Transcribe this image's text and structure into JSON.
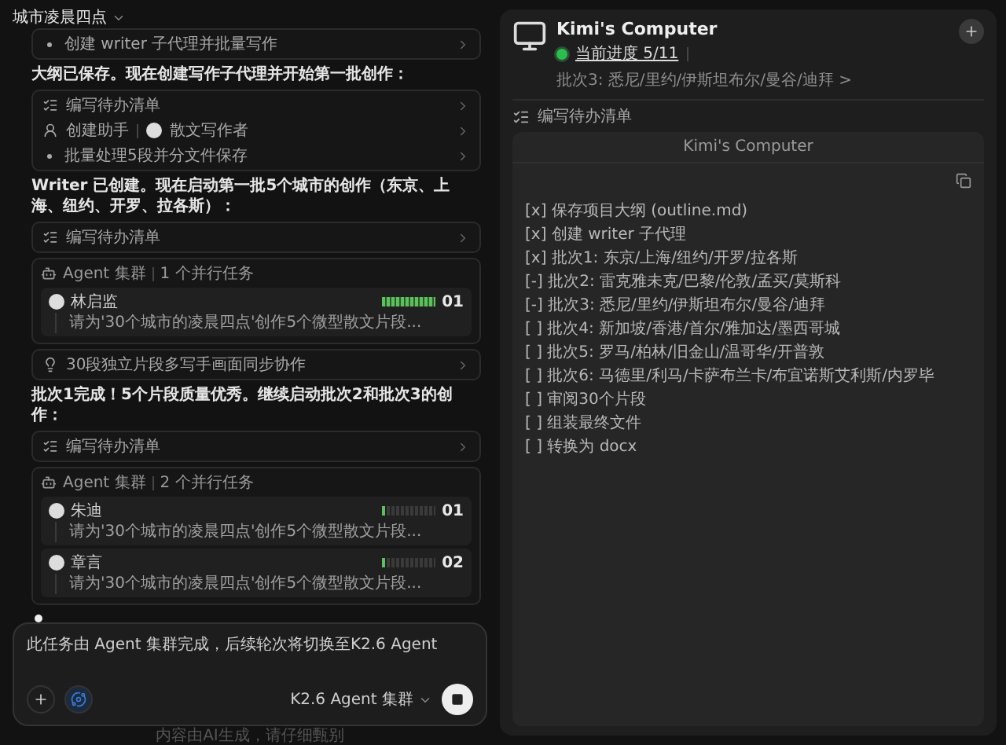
{
  "conversation": {
    "title": "城市凌晨四点"
  },
  "messages": [
    {
      "kind": "steps",
      "items": [
        {
          "kind": "bullet",
          "label": "创建 writer 子代理并批量写作"
        }
      ]
    },
    {
      "kind": "text",
      "text": "大纲已保存。现在创建写作子代理并开始第一批创作："
    },
    {
      "kind": "steps",
      "items": [
        {
          "kind": "todo",
          "label": "编写待办清单"
        },
        {
          "kind": "assistant",
          "label": "创建助手",
          "detail": "散文写作者"
        },
        {
          "kind": "bullet",
          "label": "批量处理5段并分文件保存"
        }
      ]
    },
    {
      "kind": "text",
      "text": "Writer 已创建。现在启动第一批5个城市的创作（东京、上海、纽约、开罗、拉各斯）："
    },
    {
      "kind": "steps",
      "items": [
        {
          "kind": "todo",
          "label": "编写待办清单"
        }
      ]
    },
    {
      "kind": "agents",
      "title": "Agent 集群",
      "count": "1 个并行任务",
      "tasks": [
        {
          "name": "林启监",
          "index": "01",
          "description": "请为'30个城市的凌晨四点'创作5个微型散文片段...",
          "level": 1
        }
      ]
    },
    {
      "kind": "hint",
      "label": "30段独立片段多写手画面同步协作"
    },
    {
      "kind": "text",
      "text": "批次1完成！5个片段质量优秀。继续启动批次2和批次3的创作："
    },
    {
      "kind": "steps",
      "items": [
        {
          "kind": "todo",
          "label": "编写待办清单"
        }
      ]
    },
    {
      "kind": "agents",
      "title": "Agent 集群",
      "count": "2 个并行任务",
      "tasks": [
        {
          "name": "朱迪",
          "index": "01",
          "description": "请为'30个城市的凌晨四点'创作5个微型散文片段...",
          "level": 0.05
        },
        {
          "name": "章言",
          "index": "02",
          "description": "请为'30个城市的凌晨四点'创作5个微型散文片段...",
          "level": 0.05
        }
      ]
    }
  ],
  "input": {
    "value": "此任务由 Agent 集群完成，后续轮次将切换至K2.6 Agent",
    "model": "K2.6 Agent 集群"
  },
  "footer": "内容由AI生成，请仔细甄别",
  "computer": {
    "title": "Kimi's Computer",
    "progress": "当前进度 5/11",
    "batch": "批次3: 悉尼/里约/伊斯坦布尔/曼谷/迪拜 >",
    "step": "编写待办清单",
    "panel_title": "Kimi's Computer",
    "todo": [
      "[x] 保存项目大纲 (outline.md)",
      "[x] 创建 writer 子代理",
      "[x] 批次1: 东京/上海/纽约/开罗/拉各斯",
      "[-] 批次2: 雷克雅未克/巴黎/伦敦/孟买/莫斯科",
      "[-] 批次3: 悉尼/里约/伊斯坦布尔/曼谷/迪拜",
      "[ ] 批次4: 新加坡/香港/首尔/雅加达/墨西哥城",
      "[ ] 批次5: 罗马/柏林/旧金山/温哥华/开普敦",
      "[ ] 批次6: 马德里/利马/卡萨布兰卡/布宜诺斯艾利斯/内罗毕",
      "[ ] 审阅30个片段",
      "[ ] 组装最终文件",
      "[ ] 转换为 docx"
    ]
  }
}
